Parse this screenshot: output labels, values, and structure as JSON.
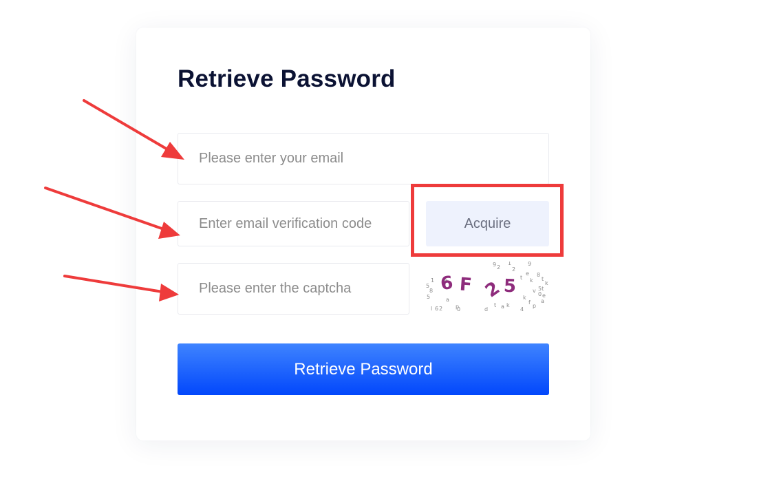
{
  "form": {
    "title": "Retrieve Password",
    "email_placeholder": "Please enter your email",
    "code_placeholder": "Enter email verification code",
    "acquire_label": "Acquire",
    "captcha_placeholder": "Please enter the captcha",
    "captcha_text": [
      "6",
      "F",
      "2",
      "5"
    ],
    "submit_label": "Retrieve Password"
  },
  "colors": {
    "primary_button": "#0247fb",
    "acquire_button_bg": "#eef2fd",
    "annotation_red": "#ee3b3b",
    "captcha_chars": "#8e2c7c"
  }
}
